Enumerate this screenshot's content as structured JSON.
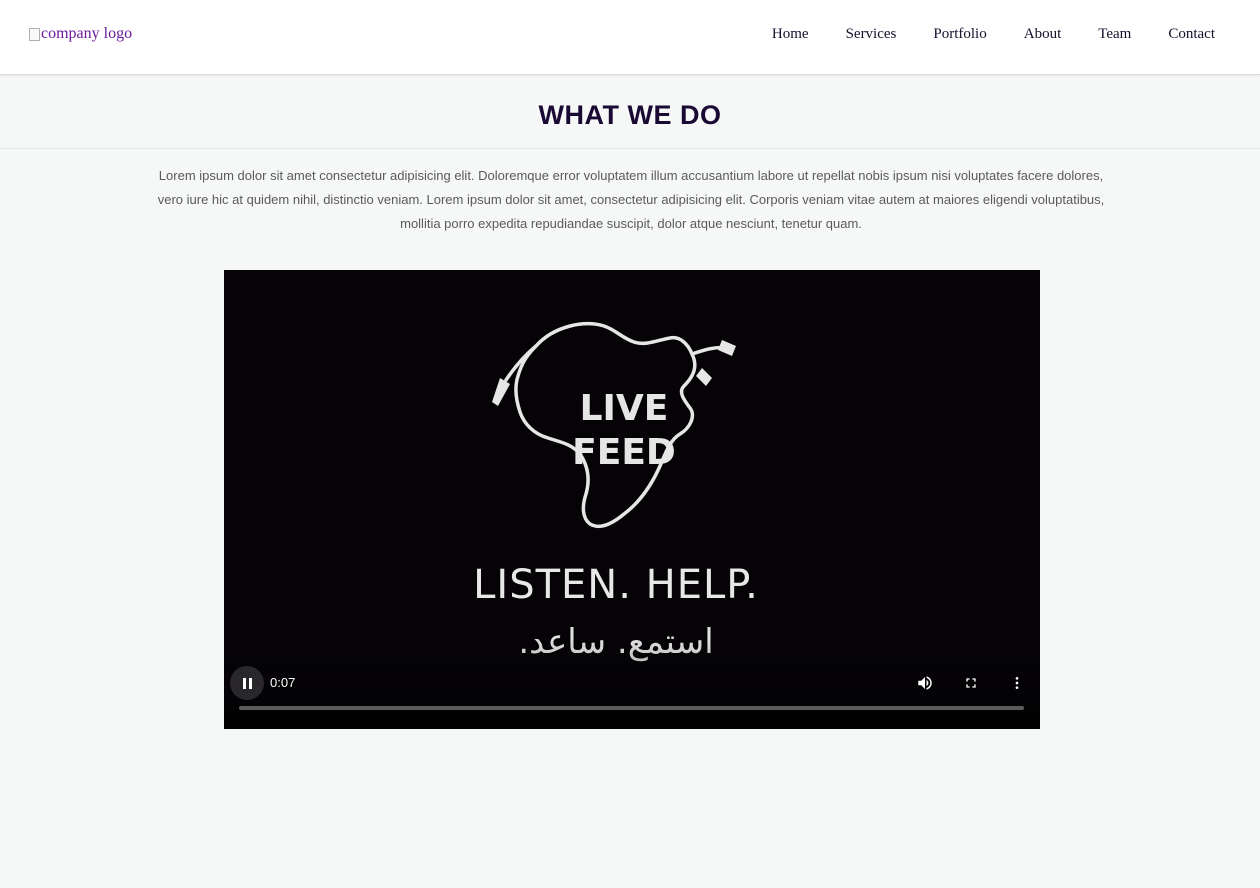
{
  "header": {
    "logo_alt": "company logo",
    "nav": [
      "Home",
      "Services",
      "Portfolio",
      "About",
      "Team",
      "Contact"
    ]
  },
  "section": {
    "title": "WHAT WE DO",
    "intro": "Lorem ipsum dolor sit amet consectetur adipisicing elit. Doloremque error voluptatem illum accusantium labore ut repellat nobis ipsum nisi voluptates facere dolores, vero iure hic at quidem nihil, distinctio veniam. Lorem ipsum dolor sit amet, consectetur adipisicing elit. Corporis veniam vitae autem at maiores eligendi voluptatibus, mollitia porro expedita repudiandae suscipit, dolor atque nesciunt, tenetur quam."
  },
  "video": {
    "logo_line1": "LIVE",
    "logo_line2": "FEED",
    "tagline": "LISTEN. HELP.",
    "tagline_arabic": "استمع. ساعد.",
    "current_time": "0:07",
    "progress": 0.0,
    "icons": [
      "pause-icon",
      "volume-icon",
      "fullscreen-icon",
      "more-options-icon"
    ]
  }
}
